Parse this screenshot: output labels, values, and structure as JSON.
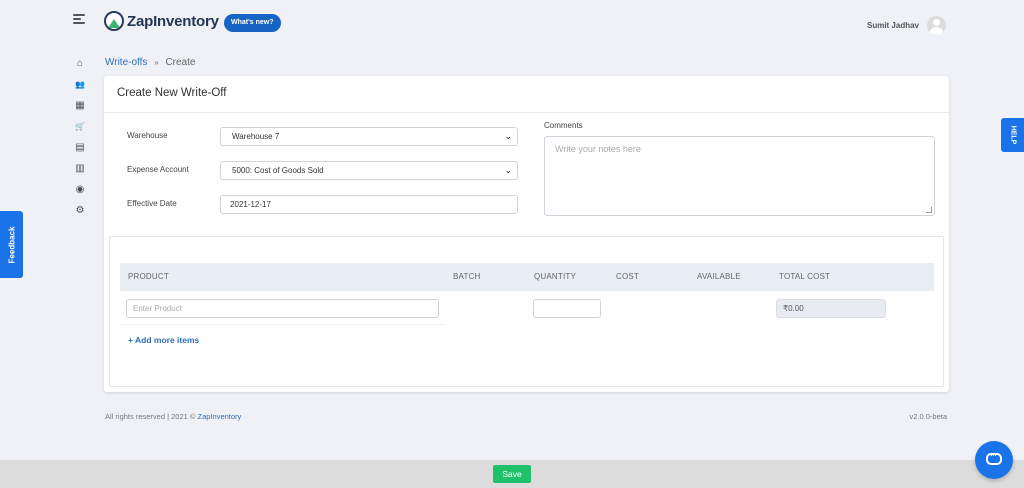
{
  "header": {
    "logo_text": "ZapInventory",
    "whats_new_label": "What's new?",
    "user_name": "Sumit Jadhav"
  },
  "sidebar": {
    "items": [
      {
        "icon": "home-icon",
        "glyph": "⌂"
      },
      {
        "icon": "users-icon",
        "glyph": "👥"
      },
      {
        "icon": "boxes-icon",
        "glyph": "▦"
      },
      {
        "icon": "cart-icon",
        "glyph": "🛒"
      },
      {
        "icon": "warehouse-icon",
        "glyph": "▤"
      },
      {
        "icon": "chart-icon",
        "glyph": "▥"
      },
      {
        "icon": "circle-icon",
        "glyph": "◉"
      },
      {
        "icon": "gear-icon",
        "glyph": "⚙"
      }
    ]
  },
  "breadcrumb": {
    "parent": "Write-offs",
    "separator": "»",
    "current": "Create"
  },
  "form": {
    "title": "Create New Write-Off",
    "warehouse_label": "Warehouse",
    "warehouse_value": "Warehouse 7",
    "expense_label": "Expense Account",
    "expense_value": "5000: Cost of Goods Sold",
    "date_label": "Effective Date",
    "date_value": "2021-12-17",
    "comments_label": "Comments",
    "comments_placeholder": "Write your notes here"
  },
  "items_table": {
    "columns": [
      "PRODUCT",
      "BATCH",
      "QUANTITY",
      "COST",
      "AVAILABLE",
      "TOTAL COST"
    ],
    "product_placeholder": "Enter Product",
    "quantity_value": "",
    "total_cost_value": "₹0.00",
    "add_more_label": "+ Add more items"
  },
  "footer": {
    "copyright": "All rights reserved | 2021 ©",
    "brand_link": "ZapInventory",
    "version": "v2.0.0-beta"
  },
  "side_tabs": {
    "feedback_label": "Feedback",
    "help_label": "HELP"
  },
  "bottom_bar": {
    "save_label": "Save"
  },
  "colors": {
    "accent": "#1a73e8",
    "save": "#1fc26b",
    "link": "#2f6fb8"
  }
}
